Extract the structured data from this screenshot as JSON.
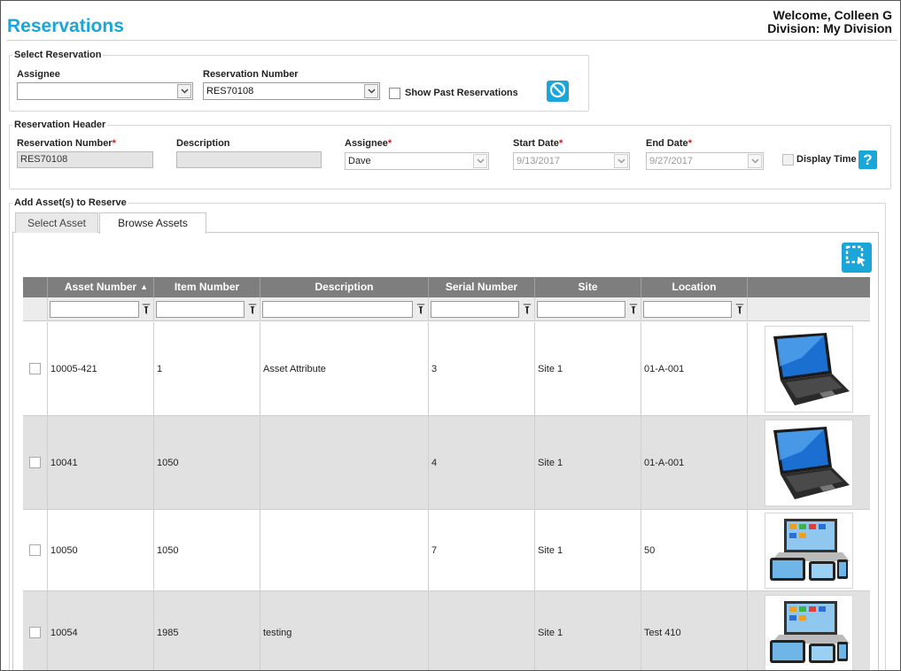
{
  "header": {
    "title": "Reservations",
    "welcome": "Welcome, Colleen G",
    "division": "Division: My Division"
  },
  "select_reservation": {
    "legend": "Select Reservation",
    "assignee_label": "Assignee",
    "assignee_value": "",
    "number_label": "Reservation Number",
    "number_value": "RES70108",
    "show_past_label": "Show Past Reservations",
    "clear_icon": "no-entry-icon"
  },
  "reservation_header": {
    "legend": "Reservation Header",
    "number_label": "Reservation Number",
    "number_value": "RES70108",
    "description_label": "Description",
    "description_value": "",
    "assignee_label": "Assignee",
    "assignee_value": "Dave",
    "start_label": "Start Date",
    "start_value": "9/13/2017",
    "end_label": "End Date",
    "end_value": "9/27/2017",
    "display_time_label": "Display Time",
    "required_mark": "*",
    "help_icon": "question-icon"
  },
  "assets": {
    "legend": "Add Asset(s) to Reserve",
    "tabs": [
      {
        "label": "Select Asset",
        "active": false
      },
      {
        "label": "Browse Assets",
        "active": true
      }
    ],
    "select_icon": "marquee-select-icon",
    "columns": [
      "Asset Number",
      "Item Number",
      "Description",
      "Serial Number",
      "Site",
      "Location"
    ],
    "sort_indicator": "▲",
    "rows": [
      {
        "asset": "10005-421",
        "item": "1",
        "description": "Asset Attribute",
        "serial": "3",
        "site": "Site 1",
        "location": "01-A-001",
        "image": "laptop-icon"
      },
      {
        "asset": "10041",
        "item": "1050",
        "description": "",
        "serial": "4",
        "site": "Site 1",
        "location": "01-A-001",
        "image": "laptop-icon"
      },
      {
        "asset": "10050",
        "item": "1050",
        "description": "",
        "serial": "7",
        "site": "Site 1",
        "location": "50",
        "image": "devices-icon"
      },
      {
        "asset": "10054",
        "item": "1985",
        "description": "testing",
        "serial": "",
        "site": "Site 1",
        "location": "Test 410",
        "image": "devices-icon"
      }
    ]
  },
  "colors": {
    "accent": "#1aa6d9",
    "grid_header": "#7e7e7e",
    "required": "#dd1111"
  }
}
